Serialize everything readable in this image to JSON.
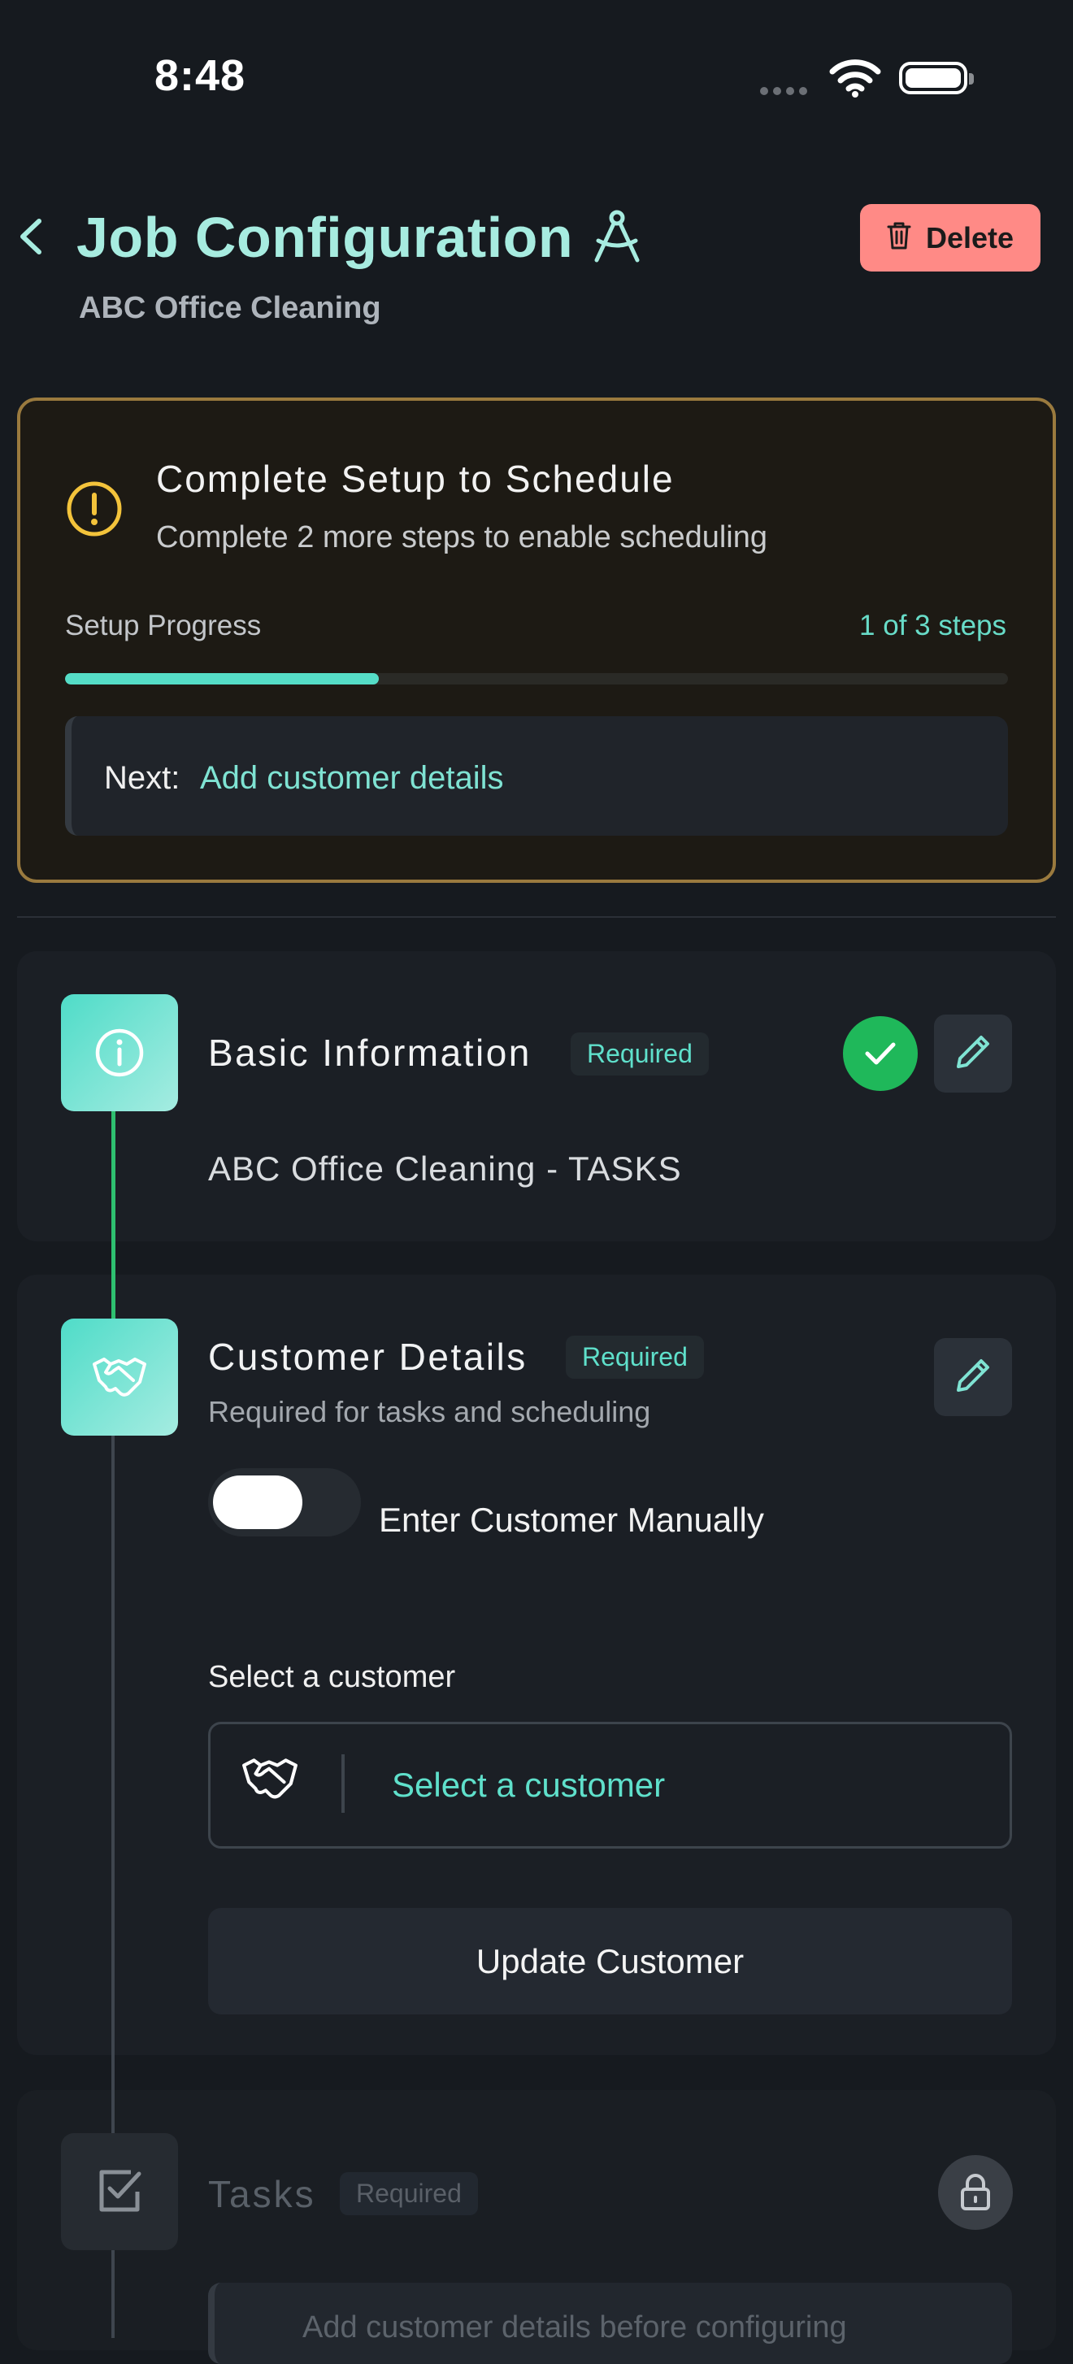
{
  "status_bar": {
    "time": "8:48"
  },
  "header": {
    "title": "Job Configuration",
    "subtitle": "ABC Office Cleaning",
    "delete_label": "Delete"
  },
  "setup": {
    "title": "Complete Setup to Schedule",
    "subtitle": "Complete 2 more steps to enable scheduling",
    "progress_label": "Setup Progress",
    "progress_count": "1 of 3 steps",
    "progress_fraction": 0.333,
    "next_label": "Next:",
    "next_value": "Add customer details"
  },
  "steps": [
    {
      "title": "Basic Information",
      "badge": "Required",
      "value": "ABC Office Cleaning - TASKS",
      "status": "complete"
    },
    {
      "title": "Customer Details",
      "badge": "Required",
      "subtitle": "Required for tasks and scheduling",
      "toggle_label": "Enter Customer Manually",
      "toggle_on": false,
      "select_label": "Select a customer",
      "select_placeholder": "Select a customer",
      "update_label": "Update Customer"
    },
    {
      "title": "Tasks",
      "badge": "Required",
      "status": "locked",
      "locked_message": "Add customer details before configuring"
    }
  ],
  "colors": {
    "accent": "#55ddc7",
    "warning_border": "#9a7a3e",
    "delete": "#ff8a86",
    "success": "#1fb85a"
  },
  "icons": [
    "back-chevron-icon",
    "compass-icon",
    "trash-icon",
    "warning-icon",
    "info-icon",
    "handshake-icon",
    "checkbox-icon",
    "pencil-icon",
    "check-icon",
    "lock-icon"
  ]
}
